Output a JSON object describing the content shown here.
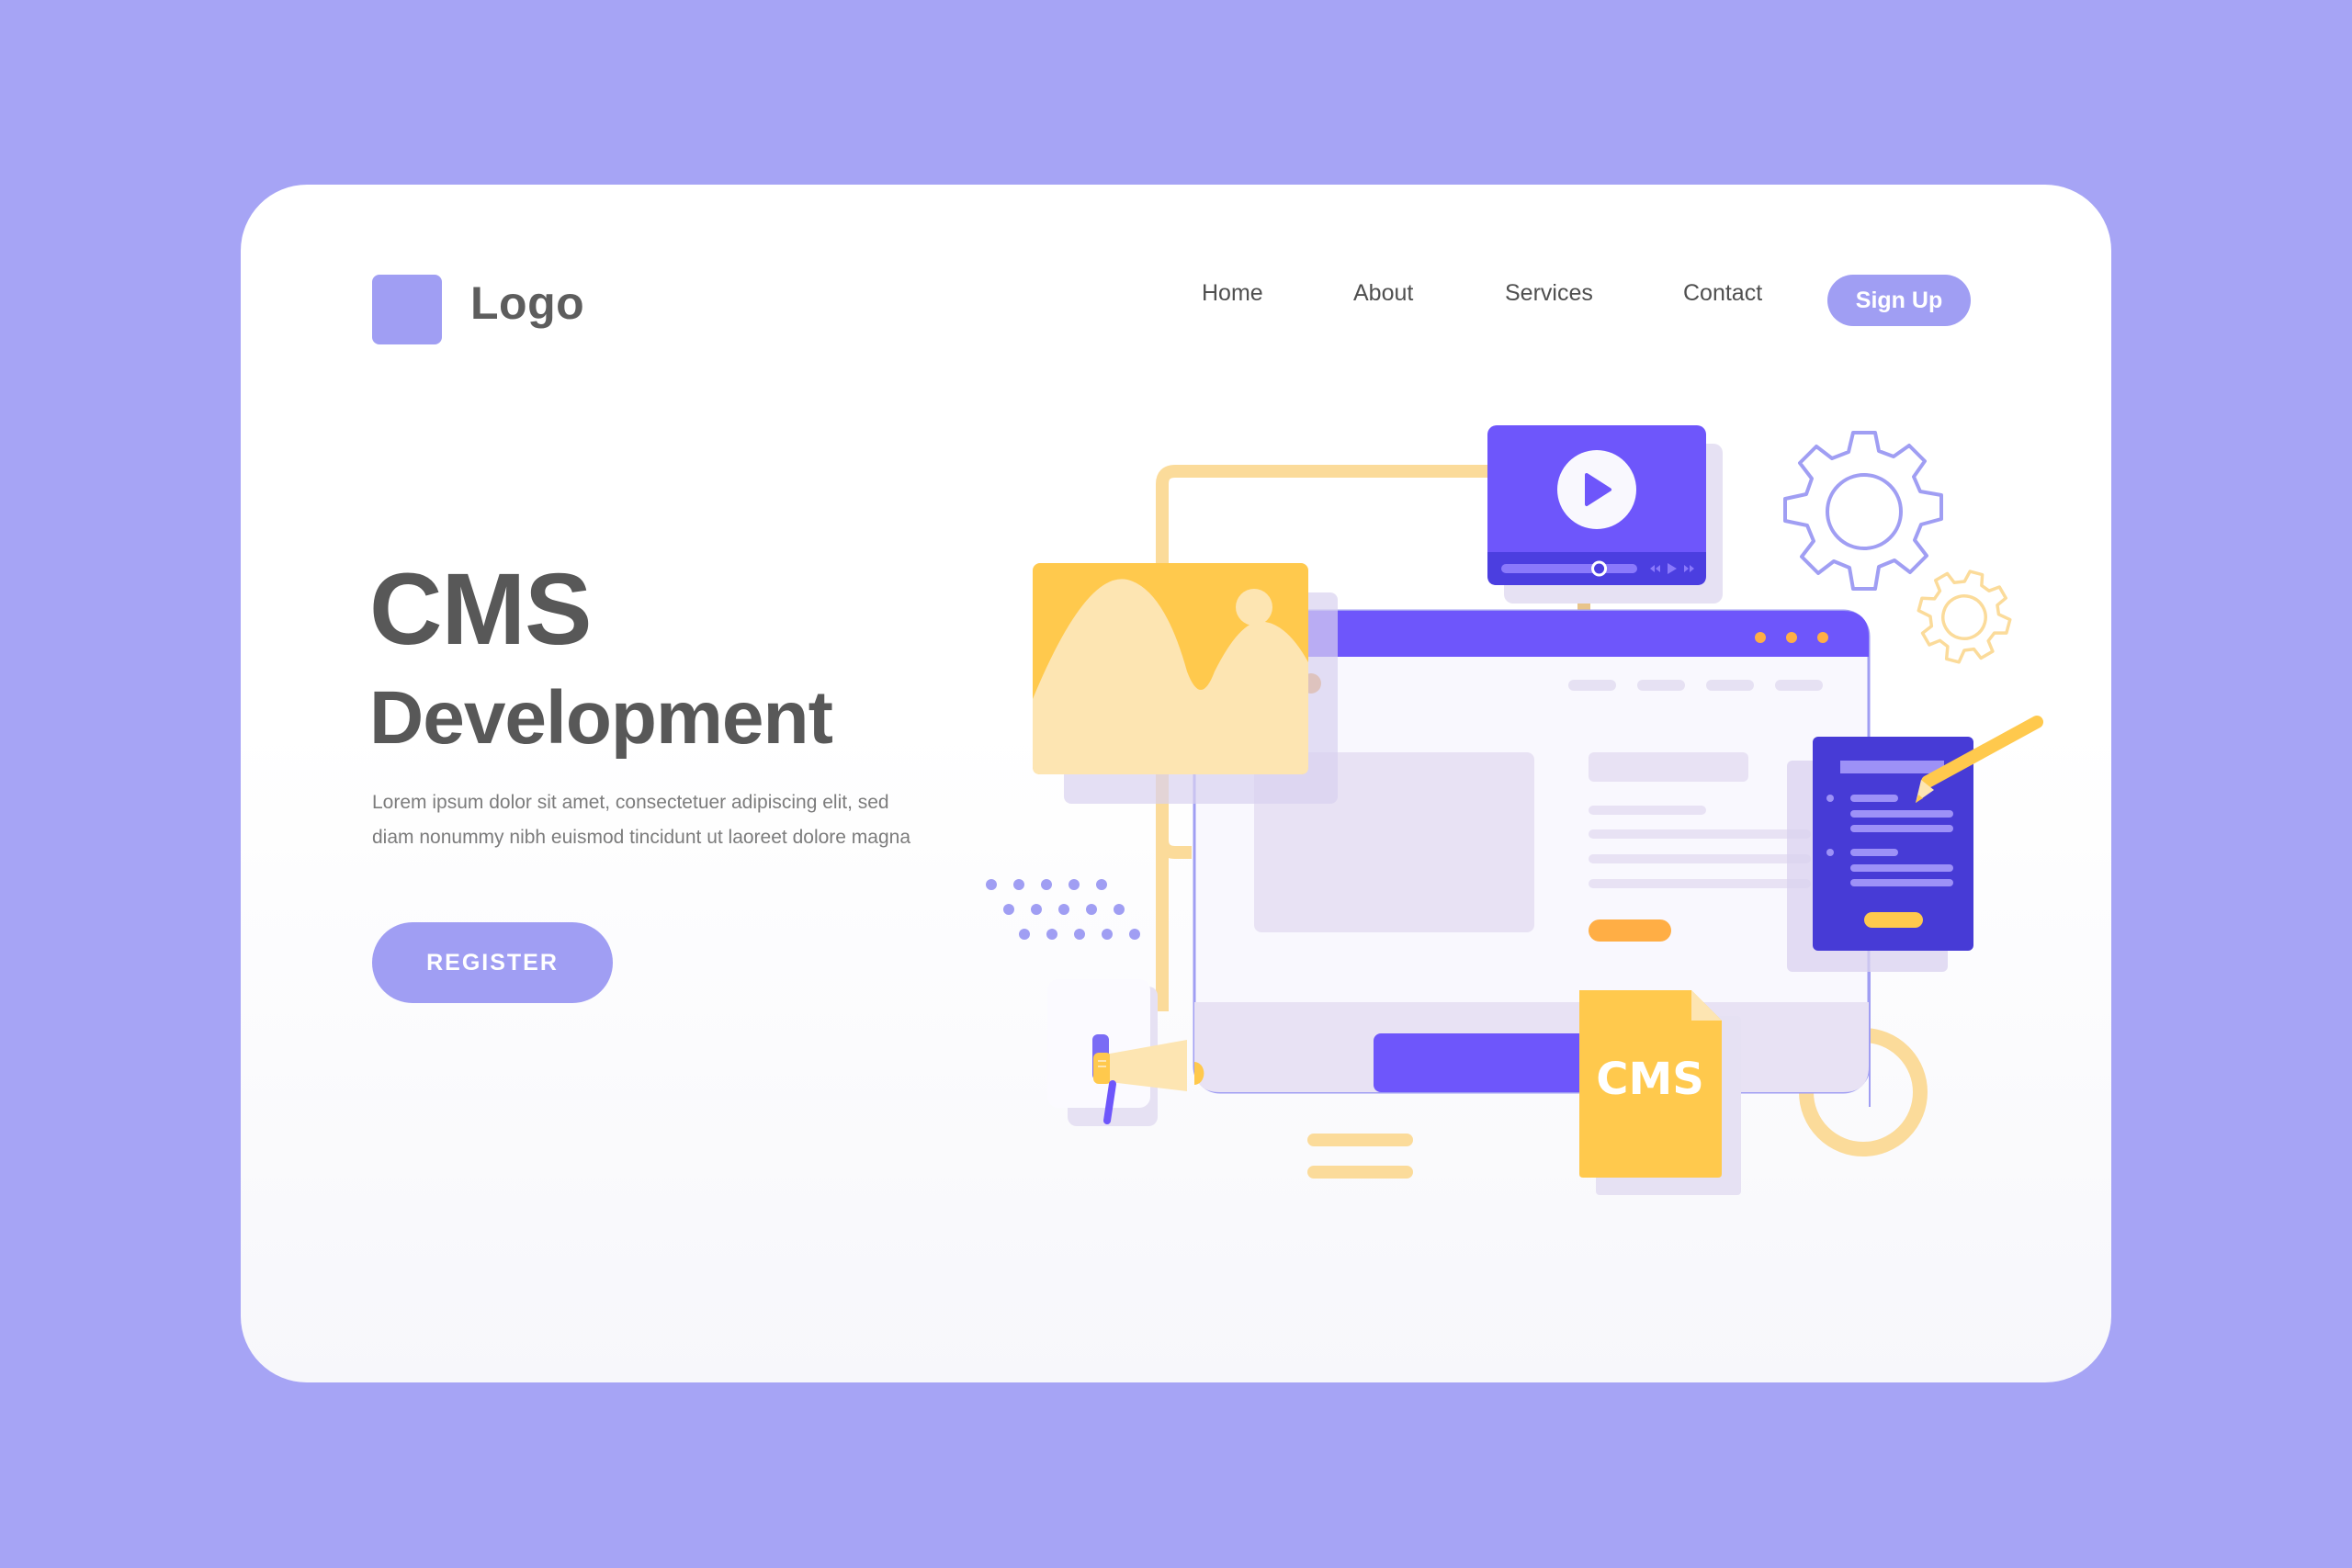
{
  "header": {
    "logo_text": "Logo",
    "nav": [
      {
        "label": "Home"
      },
      {
        "label": "About"
      },
      {
        "label": "Services"
      },
      {
        "label": "Contact"
      }
    ],
    "signup_label": "Sign Up"
  },
  "hero": {
    "title_line1": "CMS",
    "title_line2": "Development",
    "description": "Lorem ipsum dolor sit amet, consectetuer adipiscing elit, sed diam nonummy nibh euismod tincidunt ut laoreet dolore magna",
    "register_label": "REGISTER"
  },
  "illustration": {
    "file_label": "CMS",
    "video_progress": 0.72,
    "video_controls": [
      "rewind-icon",
      "play-icon",
      "fast-forward-icon"
    ],
    "icons": [
      "image-icon",
      "video-player",
      "browser-window",
      "document-icon",
      "pencil-icon",
      "megaphone-icon",
      "cms-file-icon",
      "gear-icon-large",
      "gear-icon-small"
    ]
  },
  "colors": {
    "background": "#a6a4f5",
    "accent": "#a09ef3",
    "primary_purple": "#6e56fb",
    "dark_purple": "#473bd6",
    "yellow": "#ffc94d",
    "light_yellow": "#fde5b2",
    "orange": "#ffae45",
    "text_dark": "#585858"
  }
}
